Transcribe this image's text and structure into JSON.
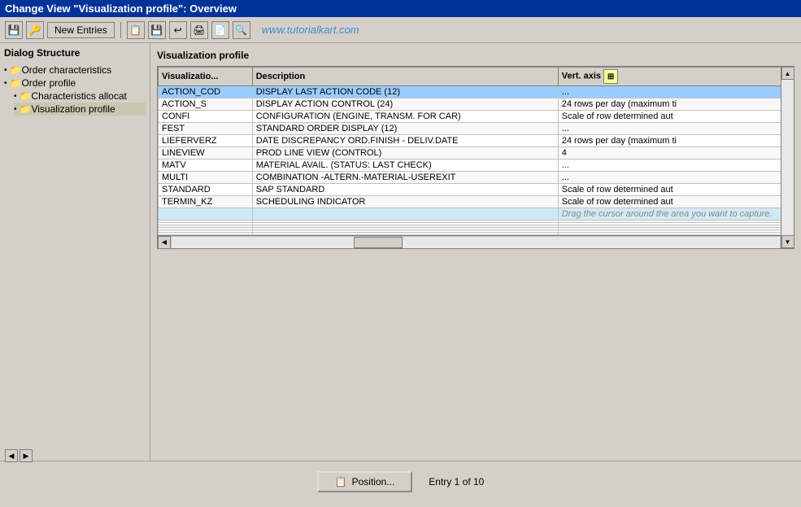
{
  "titleBar": {
    "text": "Change View \"Visualization profile\": Overview"
  },
  "toolbar": {
    "buttons": [
      "✓",
      "✗",
      "✎",
      "⊞",
      "◁",
      "▶",
      "◀",
      "▷"
    ],
    "newEntries": "New Entries",
    "watermark": "www.tutorialkart.com"
  },
  "leftPanel": {
    "title": "Dialog Structure",
    "items": [
      {
        "label": "Order characteristics",
        "level": 0,
        "bullet": "•",
        "folder": "📁",
        "expanded": true
      },
      {
        "label": "Order profile",
        "level": 0,
        "bullet": "•",
        "folder": "📁",
        "expanded": true
      },
      {
        "label": "Characteristics allocat",
        "level": 1,
        "bullet": "•",
        "folder": "📁"
      },
      {
        "label": "Visualization profile",
        "level": 1,
        "bullet": "•",
        "folder": "📁",
        "selected": true
      }
    ]
  },
  "rightPanel": {
    "title": "Visualization profile",
    "table": {
      "columns": [
        {
          "label": "Visualizatio...",
          "key": "viz"
        },
        {
          "label": "Description",
          "key": "desc"
        },
        {
          "label": "Vert. axis",
          "key": "vert"
        }
      ],
      "rows": [
        {
          "viz": "ACTION_COD",
          "desc": "DISPLAY LAST ACTION CODE (12)",
          "vert": "...",
          "highlighted": true
        },
        {
          "viz": "ACTION_S",
          "desc": "DISPLAY ACTION CONTROL (24)",
          "vert": "24 rows per day (maximum ti"
        },
        {
          "viz": "CONFI",
          "desc": "CONFIGURATION (ENGINE, TRANSM. FOR CAR)",
          "vert": "Scale of row determined aut"
        },
        {
          "viz": "FEST",
          "desc": "STANDARD ORDER DISPLAY (12)",
          "vert": "..."
        },
        {
          "viz": "LIEFERVERZ",
          "desc": "DATE DISCREPANCY ORD.FINISH - DELIV.DATE",
          "vert": "24 rows per day (maximum ti"
        },
        {
          "viz": "LINEVIEW",
          "desc": "PROD LINE VIEW (CONTROL)",
          "vert": "4"
        },
        {
          "viz": "MATV",
          "desc": "MATERIAL AVAIL. (STATUS: LAST CHECK)",
          "vert": "..."
        },
        {
          "viz": "MULTI",
          "desc": "COMBINATION -ALTERN.-MATERIAL-USEREXIT",
          "vert": "..."
        },
        {
          "viz": "STANDARD",
          "desc": "SAP STANDARD",
          "vert": "Scale of row determined aut"
        },
        {
          "viz": "TERMIN_KZ",
          "desc": "SCHEDULING INDICATOR",
          "vert": "Scale of row determined aut"
        },
        {
          "viz": "",
          "desc": "",
          "vert": "",
          "captureArea": true,
          "captureText": "Drag the cursor around the area you want to capture."
        },
        {
          "viz": "",
          "desc": "",
          "vert": ""
        },
        {
          "viz": "",
          "desc": "",
          "vert": ""
        },
        {
          "viz": "",
          "desc": "",
          "vert": ""
        },
        {
          "viz": "",
          "desc": "",
          "vert": ""
        },
        {
          "viz": "",
          "desc": "",
          "vert": ""
        },
        {
          "viz": "",
          "desc": "",
          "vert": ""
        }
      ]
    }
  },
  "bottomBar": {
    "positionLabel": "Position...",
    "entryInfo": "Entry 1 of 10"
  }
}
